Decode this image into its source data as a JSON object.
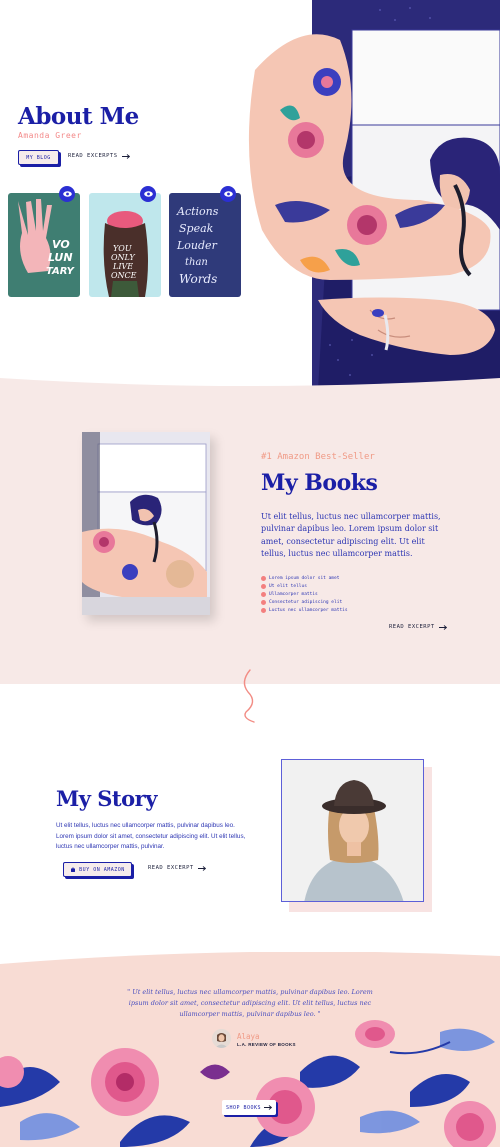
{
  "hero": {
    "title": "About Me",
    "subtitle": "Amanda Greer",
    "blog_button": "MY BLOG",
    "excerpts_link": "READ EXCERPTS",
    "book_cards": [
      {
        "name": "Voluntary",
        "text_lines": [
          "VO",
          "LUN",
          "TARY"
        ]
      },
      {
        "name": "You Only Live Once",
        "text_lines": [
          "YOU",
          "ONLY",
          "LIVE",
          "ONCE"
        ]
      },
      {
        "name": "Actions Speak Louder than Words",
        "text_lines": [
          "Actions",
          "Speak",
          "Louder",
          "than",
          "Words"
        ]
      }
    ]
  },
  "books": {
    "kicker": "#1 Amazon Best-Seller",
    "title": "My Books",
    "body": "Ut elit tellus, luctus nec ullamcorper mattis, pulvinar dapibus leo. Lorem ipsum dolor sit amet, consectetur adipiscing elit. Ut elit tellus, luctus nec ullamcorper mattis.",
    "list": [
      "Lorem ipsum dolor sit amet",
      "Ut elit tellus",
      "Ullamcorper mattis",
      "Consectetur adipiscing elit",
      "Luctus nec ullamcorper mattis"
    ],
    "excerpt_link": "READ EXCERPT"
  },
  "story": {
    "title": "My Story",
    "body": "Ut elit tellus, luctus nec ullamcorper mattis, pulvinar dapibus leo. Lorem ipsum dolor sit amet, consectetur adipiscing elit. Ut elit tellus, luctus nec ullamcorper mattis, pulvinar.",
    "buy_button": "BUY ON AMAZON",
    "excerpt_link": "READ EXCERPT"
  },
  "testimonial": {
    "quote": "\" Ut elit tellus, luctus nec ullamcorper mattis, pulvinar dapibus leo. Lorem ipsum dolor sit amet, consectetur adipiscing elit. Ut elit tellus, luctus nec ullamcorper mattis, pulvinar dapibus leo. \"",
    "name": "Alaya",
    "role": "L.A. REVIEW OF BOOKS",
    "shop_button": "SHOP BOOKS"
  },
  "colors": {
    "brand_blue": "#1b1fa6",
    "accent_pink": "#f09a86",
    "section_blush": "#f7e9e7",
    "footer_peach": "#f8dcd4"
  },
  "icons": {
    "eye": "eye-icon",
    "arrow": "arrow-right-icon",
    "cart": "cart-icon",
    "squiggle": "squiggle-divider"
  }
}
